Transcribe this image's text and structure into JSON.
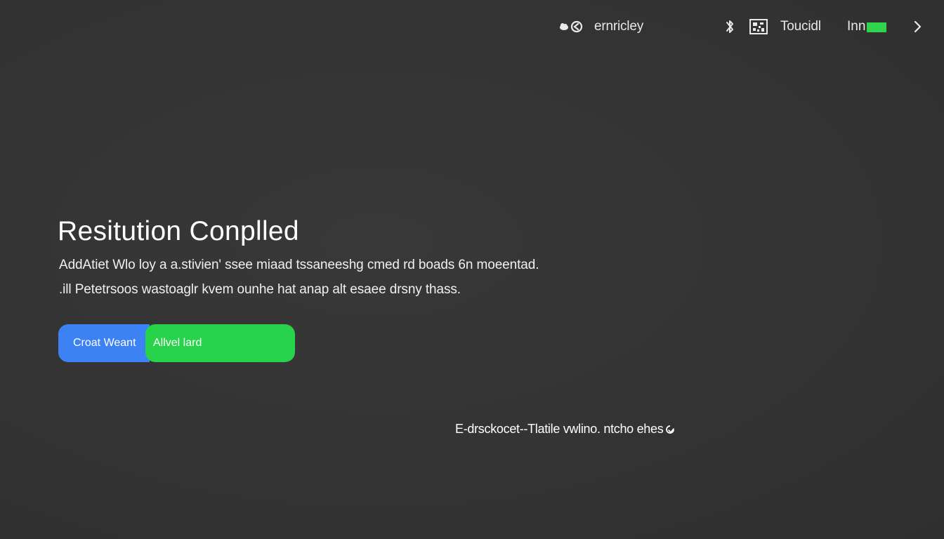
{
  "topbar": {
    "account_label": "ernricley",
    "tab_label": "Toucidl",
    "status_label": "Inn",
    "colors": {
      "status_accent": "#2fd64a"
    },
    "icons": [
      "cloud-icon",
      "refresh-icon",
      "bluetooth-icon",
      "qr-icon",
      "signal-icon",
      "chevron-right-icon"
    ]
  },
  "hero": {
    "title": "Resitution Conplled",
    "line1": "AddAtiet Wlo loy a a.stivien' ssee miaad tssaneeshg cmed rd boads 6n moeentad.",
    "line2": ".ill Petetrsoos wastoaglr kvem ounhe hat anap alt esaee drsny thass."
  },
  "actions": {
    "primary_label": "Croat Weant",
    "secondary_label": "Allvel lard",
    "colors": {
      "primary": "#3d82f4",
      "secondary": "#28d34c"
    }
  },
  "footnote": {
    "text": "E-drsckocet--Tlatile vwlino. ntcho ehes"
  }
}
